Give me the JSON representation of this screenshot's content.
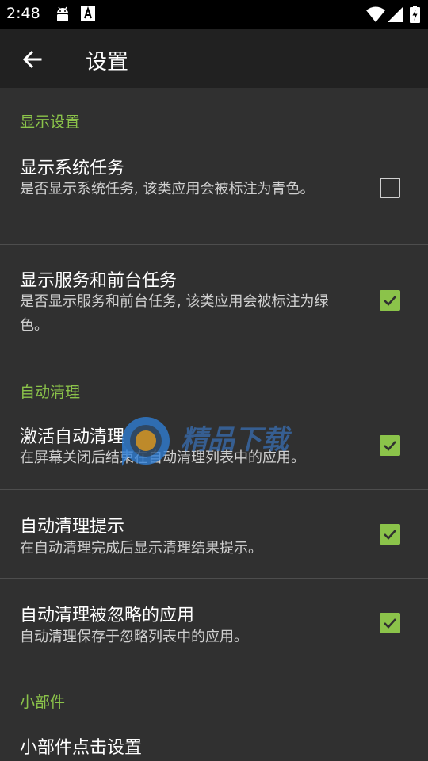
{
  "status_bar": {
    "time": "2:48",
    "icons": [
      "android-icon",
      "accessibility-a-icon",
      "wifi-icon",
      "signal-icon",
      "battery-charging-icon"
    ]
  },
  "app_bar": {
    "title": "设置",
    "back_icon": "arrow-back-icon"
  },
  "sections": [
    {
      "header": "显示设置",
      "items": [
        {
          "title": "显示系统任务",
          "summary": "是否显示系统任务, 该类应用会被标注为青色。",
          "checked": false
        },
        {
          "title": "显示服务和前台任务",
          "summary": "是否显示服务和前台任务, 该类应用会被标注为绿色。",
          "checked": true
        }
      ]
    },
    {
      "header": "自动清理",
      "items": [
        {
          "title": "激活自动清理",
          "summary": "在屏幕关闭后结束在自动清理列表中的应用。",
          "checked": true
        },
        {
          "title": "自动清理提示",
          "summary": "在自动清理完成后显示清理结果提示。",
          "checked": true
        },
        {
          "title": "自动清理被忽略的应用",
          "summary": "自动清理保存于忽略列表中的应用。",
          "checked": true
        }
      ]
    },
    {
      "header": "小部件",
      "items": [
        {
          "title": "小部件点击设置"
        }
      ]
    }
  ],
  "colors": {
    "accent": "#8bc34a",
    "background": "#303030",
    "app_bar": "#212121",
    "status_bar": "#000000",
    "divider": "#4d4d4d"
  },
  "watermark": {
    "text": "精品下载",
    "logo_icon": "watermark-logo-icon"
  }
}
